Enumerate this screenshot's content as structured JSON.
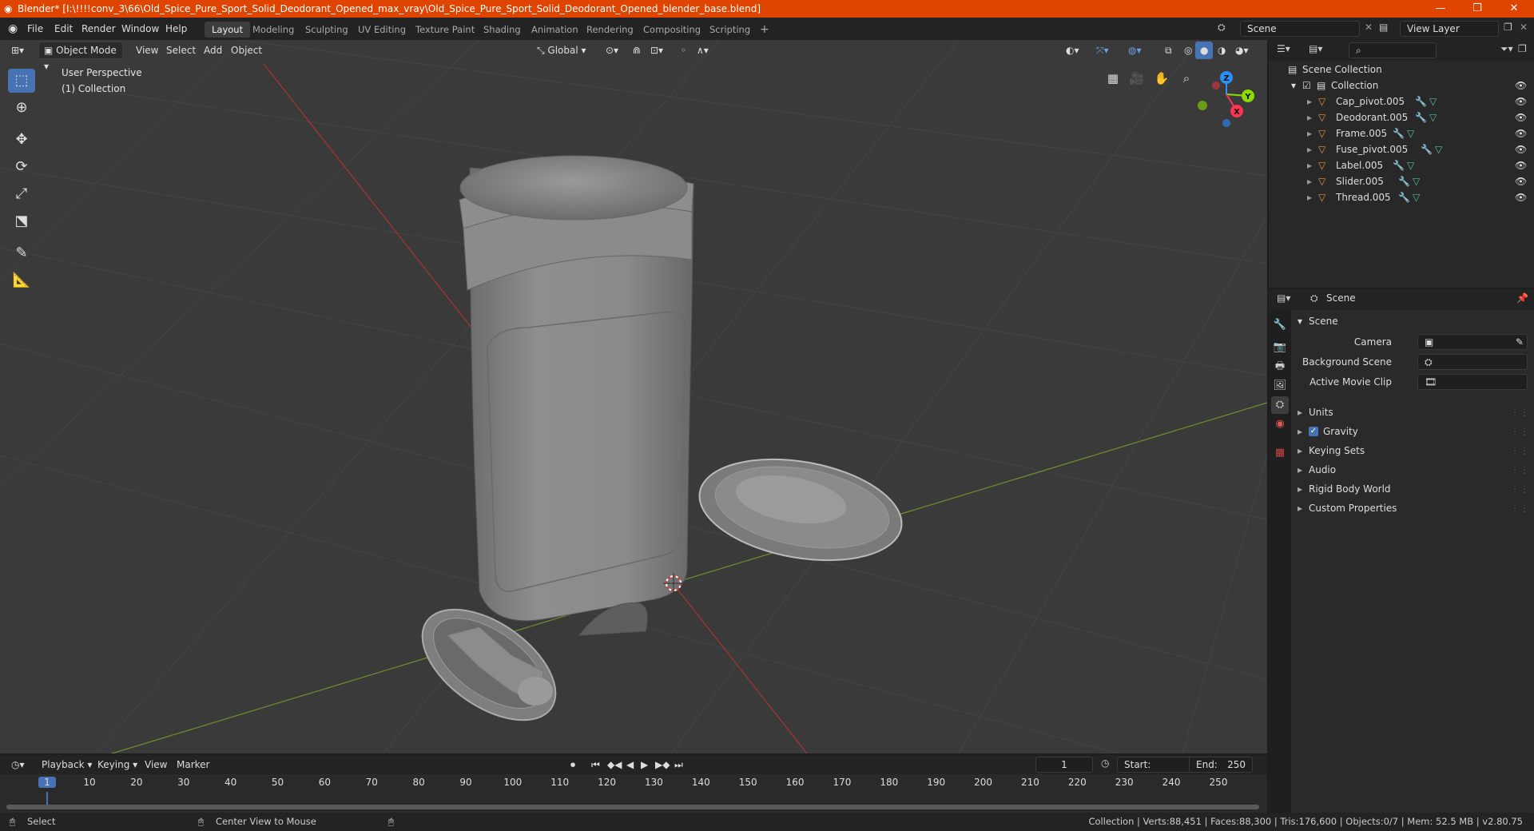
{
  "window": {
    "title": "Blender* [I:\\!!!!conv_3\\66\\Old_Spice_Pure_Sport_Solid_Deodorant_Opened_max_vray\\Old_Spice_Pure_Sport_Solid_Deodorant_Opened_blender_base.blend]",
    "minimize": "—",
    "maximize": "❐",
    "close": "✕"
  },
  "menu": [
    "File",
    "Edit",
    "Render",
    "Window",
    "Help"
  ],
  "workspaces": [
    "Layout",
    "Modeling",
    "Sculpting",
    "UV Editing",
    "Texture Paint",
    "Shading",
    "Animation",
    "Rendering",
    "Compositing",
    "Scripting"
  ],
  "active_workspace": "Layout",
  "add_workspace": "+",
  "scene_field": "Scene",
  "view_layer_field": "View Layer",
  "viewport": {
    "mode": "Object Mode",
    "menus": [
      "View",
      "Select",
      "Add",
      "Object"
    ],
    "orientation": "Global",
    "overlay_title": "User Perspective",
    "overlay_collection": "(1) Collection",
    "gizmo": {
      "x": "X",
      "y": "Y",
      "z": "Z"
    }
  },
  "outliner": {
    "root": "Scene Collection",
    "collection": "Collection",
    "items": [
      {
        "name": "Cap_pivot.005"
      },
      {
        "name": "Deodorant.005"
      },
      {
        "name": "Frame.005"
      },
      {
        "name": "Fuse_pivot.005"
      },
      {
        "name": "Label.005"
      },
      {
        "name": "Slider.005"
      },
      {
        "name": "Thread.005"
      }
    ]
  },
  "properties": {
    "context": "Scene",
    "panel": "Scene",
    "fields": [
      {
        "label": "Camera"
      },
      {
        "label": "Background Scene"
      },
      {
        "label": "Active Movie Clip"
      }
    ],
    "sections": [
      "Units",
      "Gravity",
      "Keying Sets",
      "Audio",
      "Rigid Body World",
      "Custom Properties"
    ],
    "gravity_checked": true
  },
  "timeline": {
    "menus": [
      "Playback",
      "Keying",
      "View",
      "Marker"
    ],
    "current_frame": "1",
    "start_label": "Start:",
    "start": "1",
    "end_label": "End:",
    "end": "250",
    "ticks": [
      "1",
      "10",
      "20",
      "30",
      "40",
      "50",
      "60",
      "70",
      "80",
      "90",
      "100",
      "110",
      "120",
      "130",
      "140",
      "150",
      "160",
      "170",
      "180",
      "190",
      "200",
      "210",
      "220",
      "230",
      "240",
      "250"
    ]
  },
  "status": {
    "left": "Select",
    "middle": "Center View to Mouse",
    "right": "Collection | Verts:88,451 | Faces:88,300 | Tris:176,600 | Objects:0/7 | Mem: 52.5 MB | v2.80.75"
  },
  "colors": {
    "titlebar": "#df4400",
    "accent": "#4772b3",
    "x_axis": "#ff3352",
    "y_axis": "#8bdc00",
    "z_axis": "#2890ff"
  }
}
